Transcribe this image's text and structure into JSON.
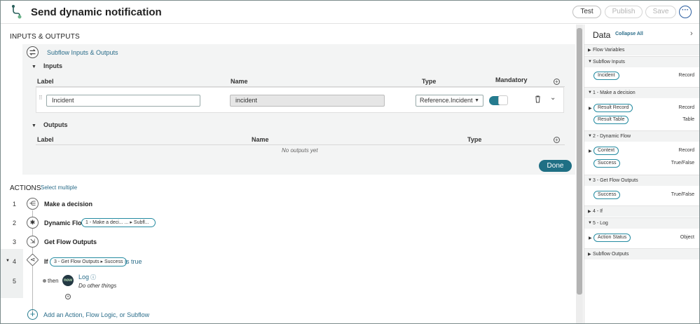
{
  "header": {
    "title": "Send dynamic notification",
    "test_label": "Test",
    "publish_label": "Publish",
    "save_label": "Save",
    "more_label": "···"
  },
  "inputs_outputs": {
    "section_title": "INPUTS & OUTPUTS",
    "subflow_link": "Subflow Inputs & Outputs",
    "inputs_label": "Inputs",
    "outputs_label": "Outputs",
    "columns": {
      "label": "Label",
      "name": "Name",
      "type": "Type",
      "mandatory": "Mandatory"
    },
    "input_row": {
      "label": "Incident",
      "name": "incident",
      "type": "Reference.Incident",
      "mandatory": true
    },
    "no_outputs": "No outputs yet",
    "done_label": "Done"
  },
  "actions": {
    "title": "ACTIONS",
    "select_multiple": "Select multiple",
    "items": [
      {
        "num": "1",
        "name": "Make a decision"
      },
      {
        "num": "2",
        "name": "Dynamic Flow",
        "pill_a": "1 - Make a deci...",
        "pill_b": "... ▸ Subfl..."
      },
      {
        "num": "3",
        "name": "Get Flow Outputs"
      },
      {
        "num": "4",
        "name": "If",
        "pill": "3 - Get Flow Outputs ▸ Success",
        "suffix": "is true"
      },
      {
        "num": "5",
        "then": "then",
        "log_title": "Log",
        "log_desc": "Do other things",
        "logo": "now"
      }
    ],
    "add_label": "Add an Action, Flow Logic, or Subflow"
  },
  "data_panel": {
    "title": "Data",
    "collapse_all": "Collapse All",
    "sections": [
      {
        "label": "Flow Variables"
      },
      {
        "label": "Subflow Inputs",
        "pills": [
          {
            "name": "Incident",
            "type": "Record"
          }
        ]
      },
      {
        "label": "1 - Make a decision",
        "pills": [
          {
            "name": "Result Record",
            "type": "Record"
          },
          {
            "name": "Result Table",
            "type": "Table"
          }
        ]
      },
      {
        "label": "2 - Dynamic Flow",
        "pills": [
          {
            "name": "Context",
            "type": "Record"
          },
          {
            "name": "Success",
            "type": "True/False"
          }
        ]
      },
      {
        "label": "3 - Get Flow Outputs",
        "pills": [
          {
            "name": "Success",
            "type": "True/False"
          }
        ]
      },
      {
        "label": "4 - If"
      },
      {
        "label": "5 - Log",
        "pills": [
          {
            "name": "Action Status",
            "type": "Object"
          }
        ]
      },
      {
        "label": "Subflow Outputs"
      }
    ]
  }
}
